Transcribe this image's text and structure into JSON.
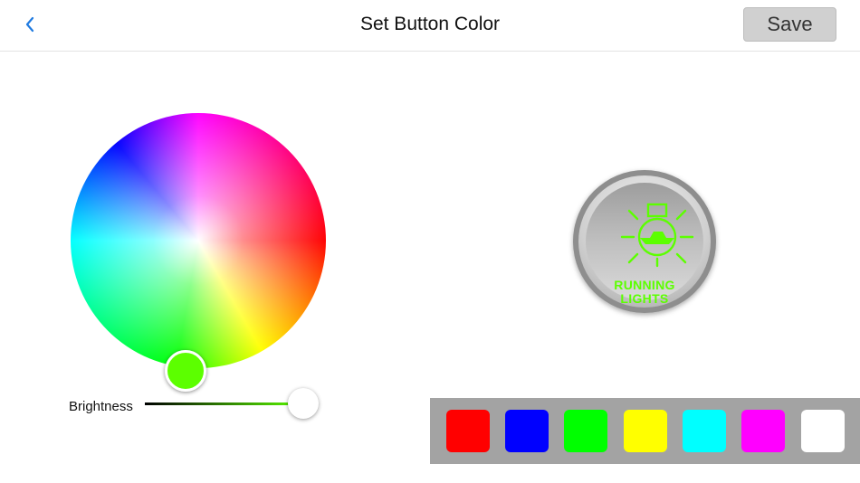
{
  "header": {
    "title": "Set Button Color",
    "save_label": "Save",
    "back_icon": "chevron-left-icon",
    "accent_color": "#1f7ae0"
  },
  "color_picker": {
    "selected_color": "#5cff00",
    "brightness_label": "Brightness",
    "brightness_value": 1.0
  },
  "preview_button": {
    "icon": "bulb-boat-icon",
    "label_line1": "RUNNING",
    "label_line2": "LIGHTS",
    "label_color": "#5cff00"
  },
  "palette": {
    "swatches": [
      {
        "name": "red",
        "color": "#ff0000"
      },
      {
        "name": "blue",
        "color": "#0000ff"
      },
      {
        "name": "green",
        "color": "#00ff00"
      },
      {
        "name": "yellow",
        "color": "#ffff00"
      },
      {
        "name": "cyan",
        "color": "#00ffff"
      },
      {
        "name": "magenta",
        "color": "#ff00ff"
      },
      {
        "name": "white",
        "color": "#ffffff"
      }
    ]
  }
}
